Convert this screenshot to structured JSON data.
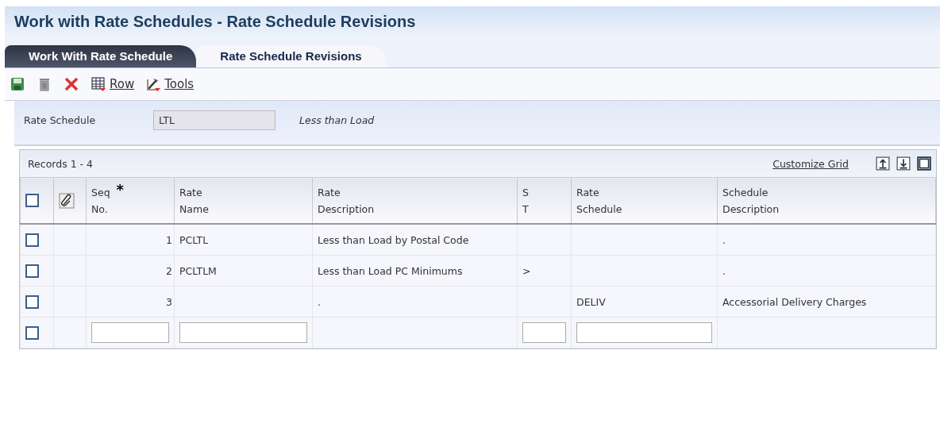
{
  "window": {
    "title": "Work with Rate Schedules - Rate Schedule Revisions"
  },
  "tabs": [
    {
      "label": "Work With Rate Schedule",
      "selected": false
    },
    {
      "label": "Rate Schedule Revisions",
      "selected": true
    }
  ],
  "toolbar": [
    {
      "kind": "save"
    },
    {
      "kind": "delete"
    },
    {
      "kind": "cancel"
    },
    {
      "kind": "rowmenu",
      "label": "Row"
    },
    {
      "kind": "toolsmenu",
      "label": "Tools"
    }
  ],
  "header": {
    "label": "Rate Schedule",
    "value": "LTL",
    "description": "Less than Load"
  },
  "grid": {
    "records": "Records 1 - 4",
    "customize": "Customize Grid",
    "columns": [
      {
        "kind": "select",
        "checked": false
      },
      {
        "kind": "attach"
      },
      {
        "kind": "text",
        "lines": [
          "Seq",
          "No."
        ],
        "required_mark": "*"
      },
      {
        "kind": "text",
        "lines": [
          "Rate",
          "Name"
        ]
      },
      {
        "kind": "text",
        "lines": [
          "Rate",
          "Description"
        ]
      },
      {
        "kind": "text",
        "lines": [
          "S",
          "T"
        ]
      },
      {
        "kind": "text",
        "lines": [
          "Rate",
          "Schedule"
        ]
      },
      {
        "kind": "text",
        "lines": [
          "Schedule",
          "Description"
        ]
      }
    ],
    "rows": [
      {
        "kind": "record",
        "checked": false,
        "cells": [
          "",
          "",
          "1",
          "PCLTL",
          "Less than Load by Postal Code",
          "",
          "",
          "."
        ]
      },
      {
        "kind": "record",
        "checked": false,
        "cells": [
          "",
          "",
          "2",
          "PCLTLM",
          "Less than Load PC Minimums",
          ">",
          "",
          "."
        ]
      },
      {
        "kind": "record",
        "checked": false,
        "cells": [
          "",
          "",
          "3",
          "",
          ".",
          "",
          "DELIV",
          "Accessorial Delivery Charges"
        ]
      },
      {
        "kind": "entry",
        "checked": false,
        "cells": [
          {
            "kind": "select"
          },
          {
            "kind": "empty"
          },
          {
            "kind": "input"
          },
          {
            "kind": "input"
          },
          {
            "kind": "empty"
          },
          {
            "kind": "input"
          },
          {
            "kind": "input"
          },
          {
            "kind": "empty"
          }
        ]
      }
    ]
  }
}
